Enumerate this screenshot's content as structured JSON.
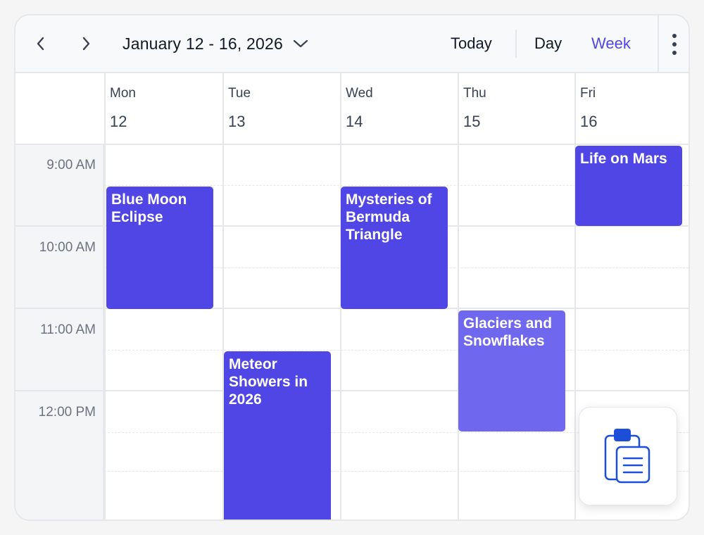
{
  "toolbar": {
    "date_range": "January 12 - 16, 2026",
    "today_label": "Today",
    "day_label": "Day",
    "week_label": "Week",
    "active_view": "Week",
    "accent_color": "#4f46e5"
  },
  "days": [
    {
      "name": "Mon",
      "date": "12"
    },
    {
      "name": "Tue",
      "date": "13"
    },
    {
      "name": "Wed",
      "date": "14"
    },
    {
      "name": "Thu",
      "date": "15"
    },
    {
      "name": "Fri",
      "date": "16"
    }
  ],
  "times": [
    "9:00 AM",
    "10:00 AM",
    "11:00 AM",
    "12:00 PM"
  ],
  "events": [
    {
      "title": "Blue Moon Eclipse",
      "day": "Mon"
    },
    {
      "title": "Mysteries of Bermuda Triangle",
      "day": "Wed"
    },
    {
      "title": "Life on Mars",
      "day": "Fri"
    },
    {
      "title": "Glaciers and Snowflakes",
      "day": "Thu"
    },
    {
      "title": "Meteor Showers in 2026",
      "day": "Tue"
    }
  ],
  "fab": {
    "icon": "clipboard-icon"
  }
}
